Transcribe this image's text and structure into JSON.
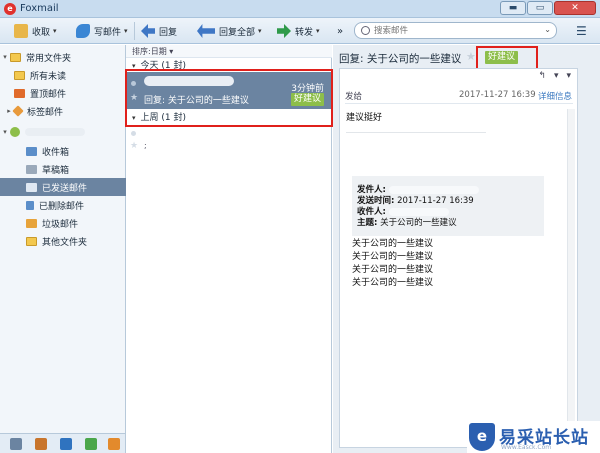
{
  "window": {
    "title": "Foxmail",
    "logo_glyph": "e"
  },
  "toolbar": {
    "receive": "收取",
    "compose": "写邮件",
    "reply": "回复",
    "reply_all": "回复全部",
    "forward": "转发",
    "more": "»",
    "search_placeholder": "搜索邮件"
  },
  "sidebar": {
    "items": [
      {
        "label": "常用文件夹",
        "icon": "folder-icon"
      },
      {
        "label": "所有未读",
        "icon": "folder-icon"
      },
      {
        "label": "置顶邮件",
        "icon": "pin-icon"
      },
      {
        "label": "标签邮件",
        "icon": "tag-icon"
      },
      {
        "label": "收件箱",
        "icon": "inbox-icon"
      },
      {
        "label": "草稿箱",
        "icon": "drafts-icon"
      },
      {
        "label": "已发送邮件",
        "icon": "sent-icon"
      },
      {
        "label": "已删除邮件",
        "icon": "trash-icon"
      },
      {
        "label": "垃圾邮件",
        "icon": "spam-icon"
      },
      {
        "label": "其他文件夹",
        "icon": "folder-icon"
      }
    ]
  },
  "maillist": {
    "sort_label": "排序:日期 ▾",
    "group_today": "今天 (1 封)",
    "group_last_week": "上周 (1 封)",
    "selected": {
      "time": "3分钟前",
      "subject": "回复: 关于公司的一些建议",
      "tag": "好建议"
    },
    "second_subject": ";"
  },
  "reader": {
    "subject": "回复: 关于公司的一些建议",
    "tag": "好建议",
    "from_label": "发给",
    "date": "2017-11-27 16:39",
    "detail_link": "详细信息",
    "body": "建议挺好",
    "quote": {
      "sender_label": "发件人:",
      "sent_label": "发送时间:",
      "sent_value": "2017-11-27 16:39",
      "to_label": "收件人:",
      "subject_label": "主题:",
      "subject_value": "关于公司的一些建议"
    },
    "quoted_lines": [
      "关于公司的一些建议",
      "关于公司的一些建议",
      "关于公司的一些建议",
      "关于公司的一些建议"
    ]
  },
  "watermark": {
    "text": "易采站长站",
    "sub": "Www.Easck.Com"
  },
  "colors": {
    "selection": "#6b84a1",
    "tag_green": "#8dbe4a",
    "highlight_red": "#e0201b",
    "link": "#3b79c0"
  }
}
